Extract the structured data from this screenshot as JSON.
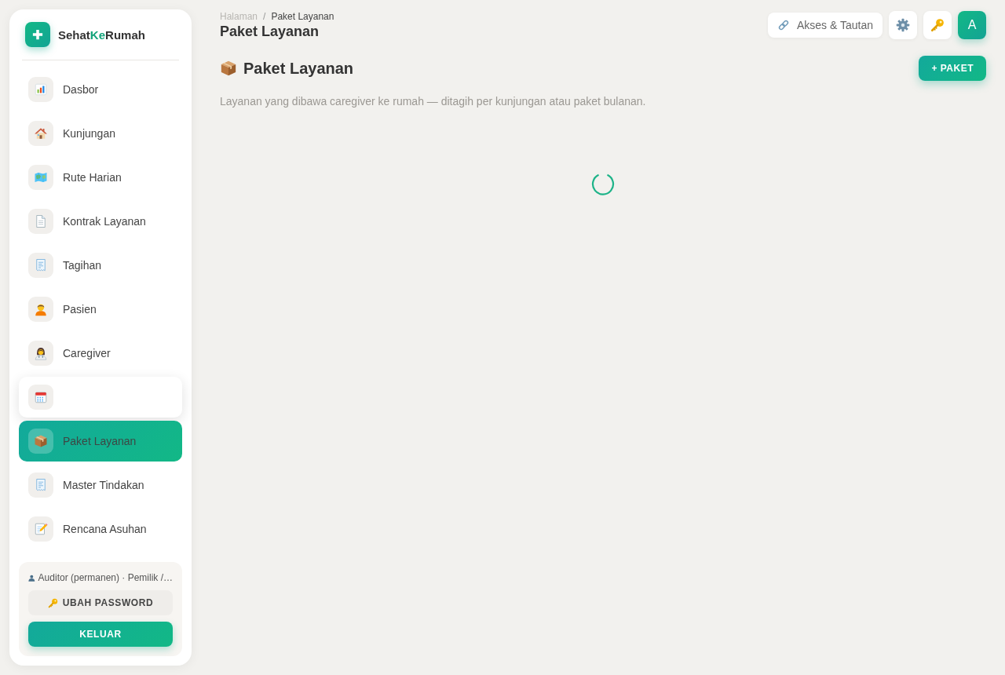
{
  "sidebar": {
    "brand": {
      "parts": [
        {
          "text": "Sehat",
          "accent": false
        },
        {
          "text": "Ke",
          "accent": true
        },
        {
          "text": "Rumah",
          "accent": false
        }
      ]
    },
    "nav_items": [
      {
        "label": "Dasbor",
        "selected": false,
        "hovered": false
      },
      {
        "label": "Kunjungan",
        "selected": false,
        "hovered": false
      },
      {
        "label": "Rute Harian",
        "selected": false,
        "hovered": false
      },
      {
        "label": "Kontrak Layanan",
        "selected": false,
        "hovered": false
      },
      {
        "label": "Tagihan",
        "selected": false,
        "hovered": false
      },
      {
        "label": "Pasien",
        "selected": false,
        "hovered": false
      },
      {
        "label": "Caregiver",
        "selected": false,
        "hovered": false
      },
      {
        "selected": false,
        "hovered": true
      },
      {
        "label": "Paket Layanan",
        "selected": true,
        "hovered": false
      },
      {
        "label": "Master Tindakan",
        "selected": false,
        "hovered": false
      },
      {
        "label": "Rencana Asuhan",
        "selected": false,
        "hovered": false
      }
    ],
    "account": {
      "label": "Auditor (permanen) · Pemilik /…",
      "change_password": "UBAH PASSWORD",
      "logout": "KELUAR"
    }
  },
  "header": {
    "breadcrumb": [
      {
        "label": "Halaman",
        "current": false
      },
      {
        "label": "Paket Layanan",
        "current": true
      }
    ],
    "separator": "/",
    "title": "Paket Layanan",
    "link_button": "Akses & Tautan",
    "avatar": "A"
  },
  "page": {
    "heading": "Paket Layanan",
    "add_button": "+ PAKET",
    "description": "Layanan yang dibawa caregiver ke rumah — ditagih per kunjungan atau paket bulanan.",
    "loading": true
  }
}
